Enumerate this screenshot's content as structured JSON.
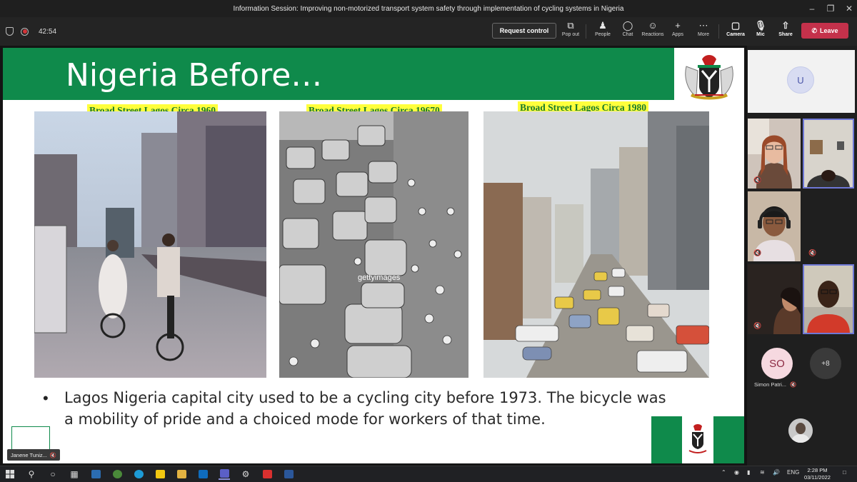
{
  "window": {
    "title": "Information Session: Improving non-motorized transport system safety through implementation of cycling systems in Nigeria"
  },
  "meeting": {
    "timer": "42:54",
    "request_control_label": "Request control",
    "toolbar": [
      {
        "label": "Pop out",
        "icon": "pop-out-icon"
      },
      {
        "label": "People",
        "icon": "people-icon"
      },
      {
        "label": "Chat",
        "icon": "chat-icon"
      },
      {
        "label": "Reactions",
        "icon": "reactions-icon"
      },
      {
        "label": "Apps",
        "icon": "apps-icon"
      },
      {
        "label": "More",
        "icon": "more-icon"
      },
      {
        "label": "Camera",
        "icon": "camera-off-icon"
      },
      {
        "label": "Mic",
        "icon": "mic-off-icon"
      },
      {
        "label": "Share",
        "icon": "share-icon"
      }
    ],
    "leave_label": "Leave"
  },
  "slide": {
    "title": "Nigeria Before…",
    "captions": [
      "Broad Street Lagos Circa 1960",
      "Broad Street Lagos Circa 19670",
      "Broad Street Lagos Circa 1980"
    ],
    "watermark": "gettyimages",
    "bullet": "Lagos Nigeria capital city used to be a cycling city before 1973. The bicycle was a mobility of pride and a choiced mode for workers of that time."
  },
  "self_view": {
    "name": "Janene Tuniz..."
  },
  "participants": {
    "avatar_u": "U",
    "avatar_so": "SO",
    "so_name": "Simon Patri...",
    "overflow": "+8"
  },
  "tray": {
    "lang": "ENG",
    "time": "2:28 PM",
    "date": "03/11/2022"
  },
  "colors": {
    "slide_green": "#0f8a4b",
    "caption_yellow": "#ffff3c",
    "leave_red": "#c4314b"
  }
}
